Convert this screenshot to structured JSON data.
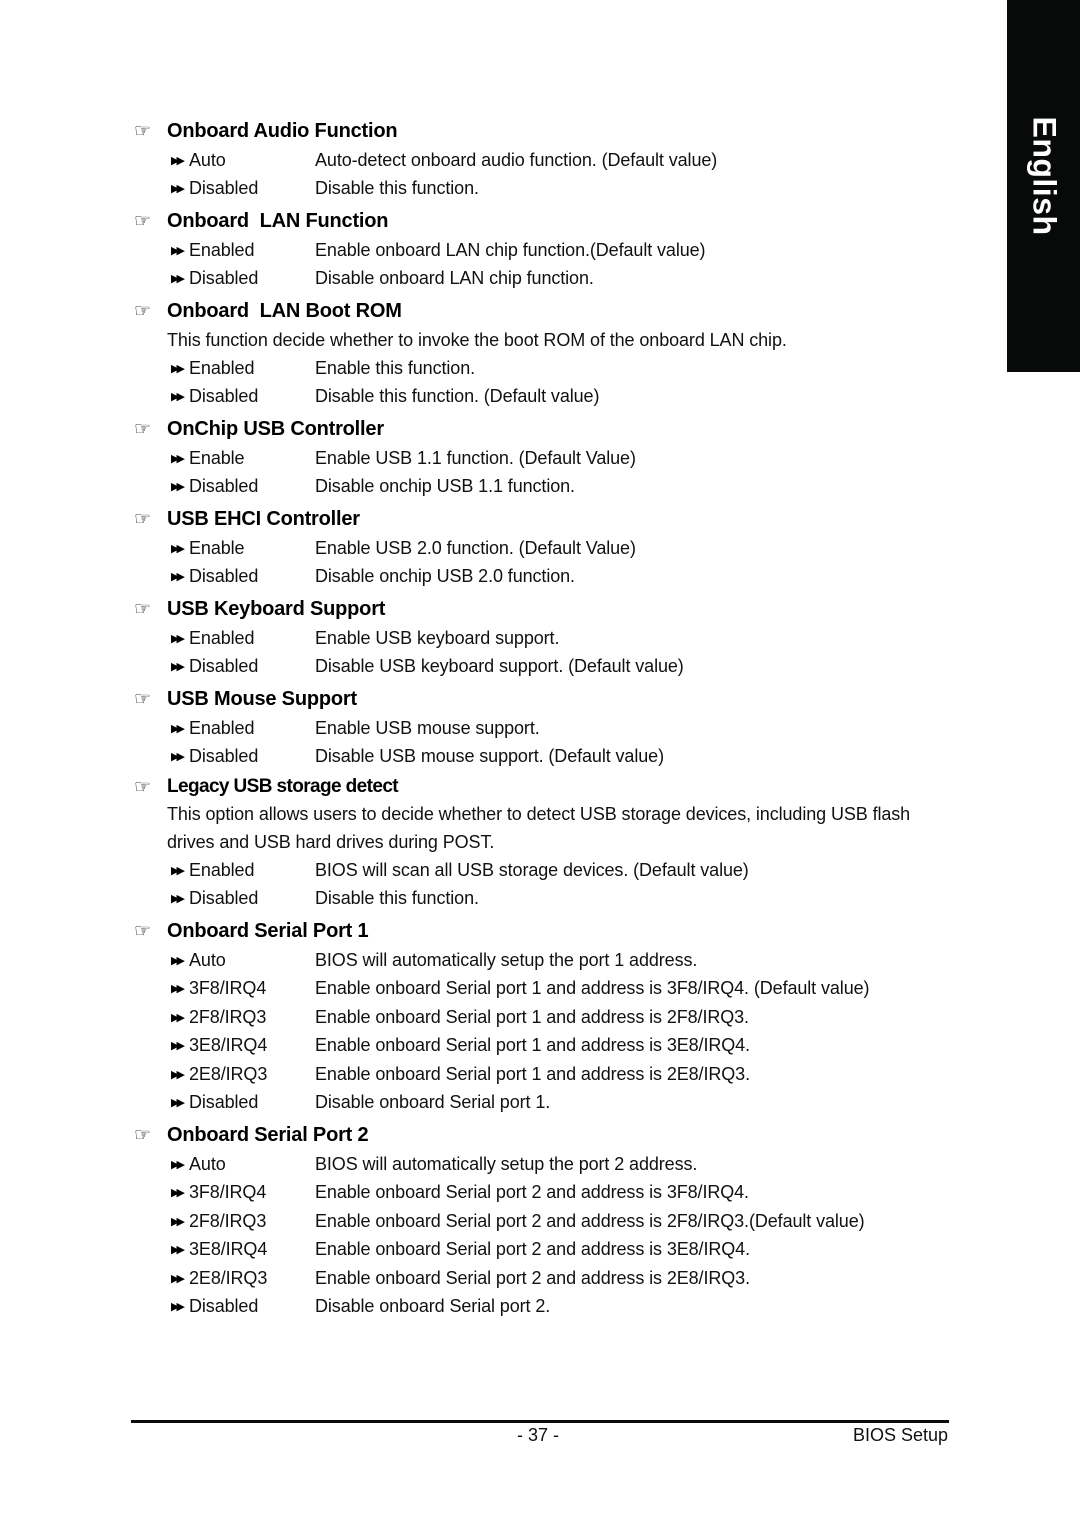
{
  "side_tab": {
    "label": "English"
  },
  "sections": [
    {
      "title": "Onboard Audio Function",
      "options": [
        {
          "value": "Auto",
          "text": "Auto-detect onboard audio function. (Default value)"
        },
        {
          "value": "Disabled",
          "text": "Disable this function."
        }
      ]
    },
    {
      "title": "Onboard  LAN Function",
      "options": [
        {
          "value": "Enabled",
          "text": "Enable onboard LAN chip function.(Default value)"
        },
        {
          "value": "Disabled",
          "text": "Disable onboard LAN chip function."
        }
      ]
    },
    {
      "title": "Onboard  LAN Boot ROM",
      "description": "This function decide whether to invoke the boot ROM of the onboard LAN chip.",
      "options": [
        {
          "value": "Enabled",
          "text": "Enable this function."
        },
        {
          "value": "Disabled",
          "text": "Disable this function. (Default value)"
        }
      ]
    },
    {
      "title": "OnChip USB Controller",
      "options": [
        {
          "value": "Enable",
          "text": "Enable USB 1.1 function. (Default Value)"
        },
        {
          "value": "Disabled",
          "text": "Disable onchip USB 1.1 function."
        }
      ]
    },
    {
      "title": "USB EHCI Controller",
      "options": [
        {
          "value": "Enable",
          "text": "Enable USB 2.0 function. (Default Value)"
        },
        {
          "value": "Disabled",
          "text": "Disable onchip USB 2.0 function."
        }
      ]
    },
    {
      "title": "USB Keyboard Support",
      "options": [
        {
          "value": "Enabled",
          "text": "Enable USB keyboard support."
        },
        {
          "value": "Disabled",
          "text": "Disable USB keyboard support. (Default value)"
        }
      ]
    },
    {
      "title": "USB Mouse Support",
      "options": [
        {
          "value": "Enabled",
          "text": "Enable USB mouse support."
        },
        {
          "value": "Disabled",
          "text": "Disable USB mouse support. (Default value)"
        }
      ]
    },
    {
      "title": "Legacy USB storage detect",
      "description": "This option allows users to decide whether to detect USB storage devices, including USB flash drives and USB hard drives during POST.",
      "options": [
        {
          "value": "Enabled",
          "text": "BIOS will scan all USB storage devices. (Default value)"
        },
        {
          "value": "Disabled",
          "text": "Disable this function."
        }
      ]
    },
    {
      "title": "Onboard Serial Port 1",
      "options": [
        {
          "value": "Auto",
          "text": "BIOS will automatically setup the port 1 address."
        },
        {
          "value": "3F8/IRQ4",
          "text": "Enable onboard Serial port 1 and address is 3F8/IRQ4. (Default value)"
        },
        {
          "value": "2F8/IRQ3",
          "text": "Enable onboard Serial port 1 and address is 2F8/IRQ3."
        },
        {
          "value": "3E8/IRQ4",
          "text": "Enable onboard Serial port 1 and address is 3E8/IRQ4."
        },
        {
          "value": "2E8/IRQ3",
          "text": "Enable onboard Serial port 1 and address is 2E8/IRQ3."
        },
        {
          "value": "Disabled",
          "text": "Disable onboard Serial port 1."
        }
      ]
    },
    {
      "title": "Onboard Serial Port 2",
      "options": [
        {
          "value": "Auto",
          "text": "BIOS will automatically setup the port 2 address."
        },
        {
          "value": "3F8/IRQ4",
          "text": "Enable onboard Serial port 2 and address is 3F8/IRQ4."
        },
        {
          "value": "2F8/IRQ3",
          "text": "Enable onboard Serial port 2 and address is 2F8/IRQ3.(Default value)"
        },
        {
          "value": "3E8/IRQ4",
          "text": "Enable onboard Serial port 2 and address is 3E8/IRQ4."
        },
        {
          "value": "2E8/IRQ3",
          "text": "Enable onboard Serial port 2 and address is 2E8/IRQ3."
        },
        {
          "value": "Disabled",
          "text": "Disable onboard Serial port 2."
        }
      ]
    }
  ],
  "icons": {
    "section_bullet": "pointing-hand-icon",
    "option_bullet": "double-arrow-icon"
  },
  "footer": {
    "page_number": "- 37 -",
    "title": "BIOS Setup"
  }
}
